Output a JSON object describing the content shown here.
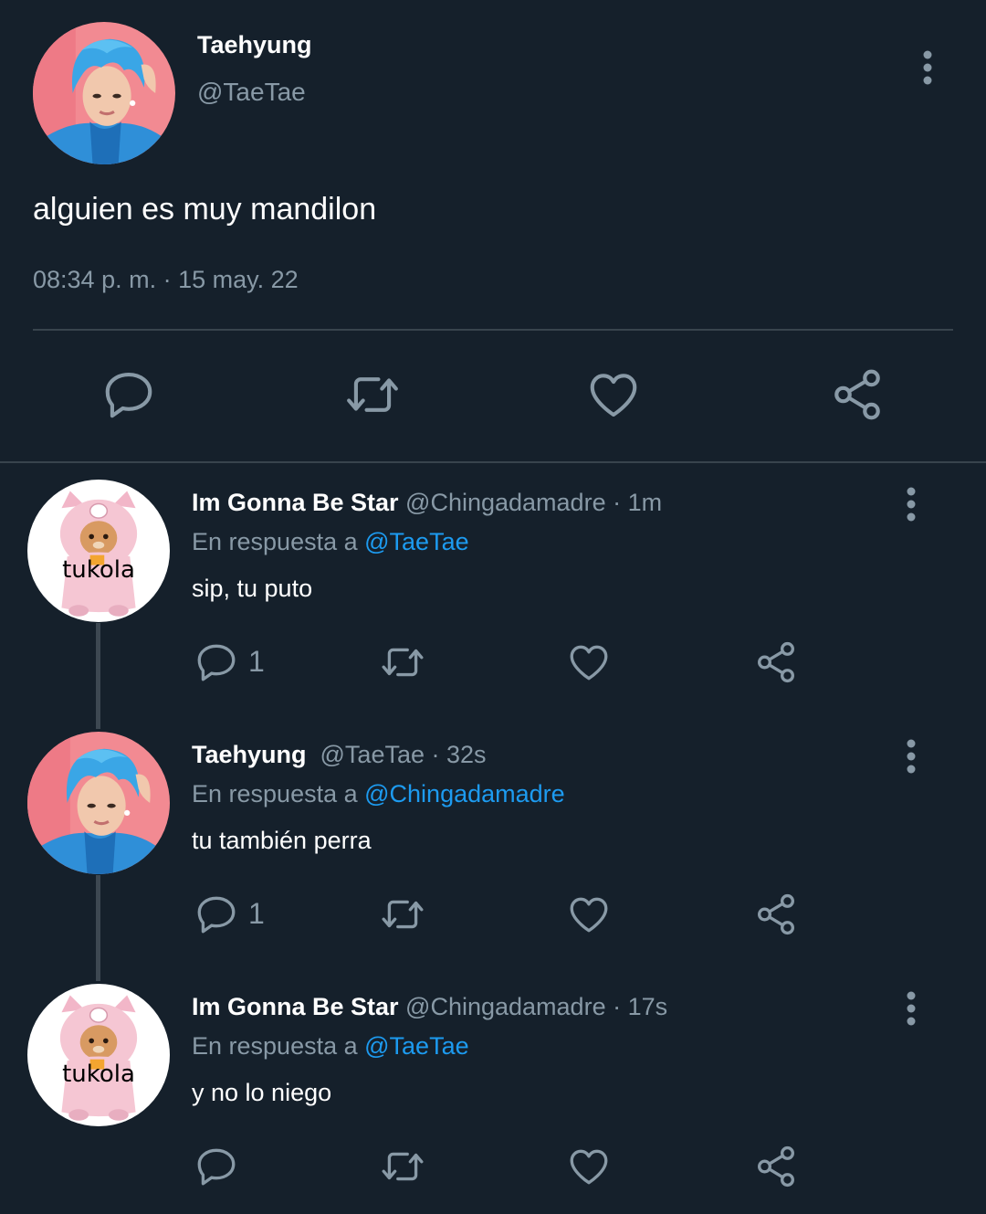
{
  "tweet": {
    "author_name": "Taehyung",
    "author_handle": "@TaeTae",
    "text": "alguien es muy mandilon",
    "timestamp": "08:34 p. m. · 15 may. 22"
  },
  "replies": [
    {
      "name": "Im Gonna Be Star",
      "meta": " @Chingadamadre · 1m",
      "context_prefix": "En respuesta a ",
      "mention": "@TaeTae",
      "text": "sip, tu puto",
      "reply_count": "1",
      "avatar_label": "tukola"
    },
    {
      "name": "Taehyung",
      "meta": "  @TaeTae · 32s",
      "context_prefix": "En respuesta a ",
      "mention": "@Chingadamadre",
      "text": "tu también perra",
      "reply_count": "1"
    },
    {
      "name": "Im Gonna Be Star",
      "meta": " @Chingadamadre · 17s",
      "context_prefix": "En respuesta a ",
      "mention": "@TaeTae",
      "text": "y no lo niego",
      "avatar_label": "tukola"
    }
  ],
  "icons": {
    "reply": "reply-icon",
    "retweet": "retweet-icon",
    "like": "like-icon",
    "share": "share-icon",
    "more": "more-vertical-icon"
  },
  "colors": {
    "background": "#15202b",
    "secondary_text": "#8899a6",
    "link": "#1d9bf0",
    "divider": "#38444d"
  }
}
